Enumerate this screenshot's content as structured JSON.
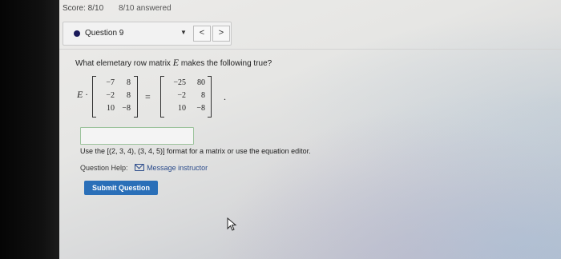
{
  "header": {
    "score": "Score: 8/10",
    "answered": "8/10 answered"
  },
  "question_nav": {
    "label": "Question 9",
    "caret_icon": "caret-down-icon",
    "prev_icon": "<",
    "next_icon": ">"
  },
  "question": {
    "prompt_before": "What elemetary row matrix",
    "prompt_var": "E",
    "prompt_after": "makes the following true?",
    "equation": {
      "left_var": "E",
      "dot": "·",
      "lhs_matrix": [
        [
          "−7",
          "8"
        ],
        [
          "−2",
          "8"
        ],
        [
          "10",
          "−8"
        ]
      ],
      "equals": "=",
      "rhs_matrix": [
        [
          "−25",
          "80"
        ],
        [
          "−2",
          "8"
        ],
        [
          "10",
          "−8"
        ]
      ],
      "trailing": "."
    }
  },
  "answer": {
    "value": "",
    "hint": "Use the [(2, 3, 4), (3, 4, 5)] format for a matrix or use the equation editor."
  },
  "help": {
    "label": "Question Help:",
    "message_link": "Message instructor"
  },
  "submit": {
    "label": "Submit Question"
  },
  "colors": {
    "accent": "#2a6fb8",
    "link": "#2a4a8a",
    "answer_border": "#9cc39c"
  }
}
